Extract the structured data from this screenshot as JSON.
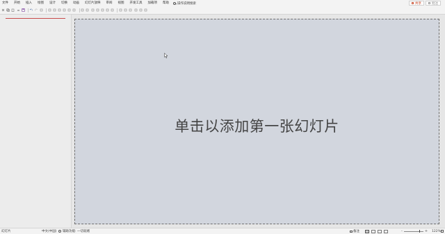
{
  "menu": {
    "items": [
      "文件",
      "开始",
      "插入",
      "绘图",
      "设计",
      "切换",
      "动画",
      "幻灯片放映",
      "审阅",
      "视图",
      "开发工具",
      "加载项",
      "帮助"
    ],
    "tell_me": "操作说明搜索",
    "share": "共享",
    "comments": "批注"
  },
  "toolbar": {
    "icons": [
      "cut-icon",
      "copy-icon",
      "paste-icon",
      "undo-history-icon",
      "save-icon",
      "undo-icon",
      "redo-icon",
      "format-painter-icon",
      "new-slide-icon",
      "shape-icon",
      "star-icon",
      "align-left-icon",
      "align-center-icon",
      "align-right-icon",
      "distribute-icon",
      "triangle-icon",
      "text-box-icon",
      "group-icon",
      "ungroup-icon",
      "bring-forward-icon",
      "send-backward-icon",
      "crop-icon",
      "rotate-icon",
      "arrange-icon",
      "picture-icon",
      "chart-icon",
      "more-icon"
    ]
  },
  "slide": {
    "placeholder": "单击以添加第一张幻灯片"
  },
  "status": {
    "slide_count": "幻灯片",
    "language": "中文(中国)",
    "accessibility": "辅助功能: 一切就绪",
    "notes": "备注",
    "zoom_minus": "-",
    "zoom_plus": "+",
    "zoom_percent": "122%"
  },
  "colors": {
    "slide_bg": "#d2d6de",
    "accent_red": "#c43e1c",
    "chrome": "#f3f3f3"
  }
}
